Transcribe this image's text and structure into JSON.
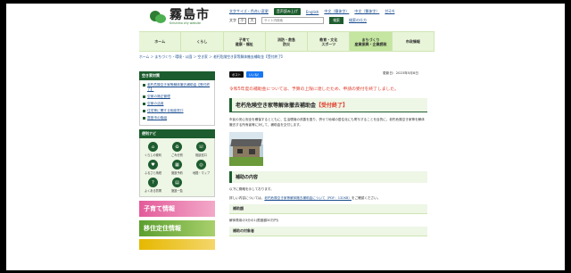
{
  "header": {
    "logo_title": "霧島市",
    "logo_sub": "Kirishima city website",
    "util_links": [
      "文字サイズ・色合い変更",
      "English",
      "中文（簡体字）",
      "中文（繁体字）",
      "한국어"
    ],
    "voice_label": "音声読み上げ",
    "size_label": "文字",
    "size_small": "小",
    "size_large": "大",
    "search_placeholder": "サイト内検索",
    "search_button": "検索",
    "search_help": "検索の仕方"
  },
  "nav": {
    "items": [
      "ホーム",
      "くらし",
      "子育て\n健康・福祉",
      "消防・救急\n防災",
      "教育・文化\nスポーツ",
      "まちづくり\n産業振興・企業誘致",
      "市政情報"
    ]
  },
  "breadcrumb": "ホーム ＞ まちづくり・環境・公園 ＞ 空き家 ＞ 老朽危険空き家等解体撤去補助金【受付終了】",
  "sidebar": {
    "head": "空き家対策",
    "links": [
      "老朽危険空き家等解体撤去補助金【受付終了】",
      "空家の適正管理",
      "空家の活用",
      "住宅等に関する相談窓口",
      "霧島市の取組"
    ],
    "navi_head": "便利ナビ",
    "navi_items": [
      "くらしの便利",
      "ごみ分別",
      "相談窓口",
      "ふるさと納税",
      "施設予約",
      "地図・マップ",
      "よくある質問",
      "施設一覧"
    ],
    "navi_icons": [
      "⌂",
      "♻",
      "☏",
      "♥",
      "▦",
      "◎",
      "?",
      "▤"
    ],
    "banner1": "子育て情報",
    "banner2": "移住定住情報"
  },
  "main": {
    "share_x": "ポスト",
    "share_fb": "いいね！",
    "updated": "更新日：2023年5月8日",
    "notice": "令和5年度の補助金については、予算の上限に達したため、申請の受付を終了しました。",
    "title": "老朽危険空き家等解体撤去補助金",
    "title_tag": "【受付終了】",
    "desc": "市民の安心安全を確保するとともに、生活環境の改善を図り、併せて地域の居住化にも寄与することを目的に、老朽危険空き家等を解体撤去する所有者等に対して、補助金を交付します。",
    "section1_head": "補助の内容",
    "section1_text": "以下に概略を示しております。",
    "section1_text2_prefix": "詳しい内容については、",
    "section1_link": "老朽危険空き家等解体撤去補助金について（PDF：132KB）",
    "section1_text2_suffix": "をご確認ください。",
    "sub1": "補助額",
    "sub1_text": "解体費用の3分の1(限度額30万円)",
    "sub2": "補助の対象者"
  }
}
